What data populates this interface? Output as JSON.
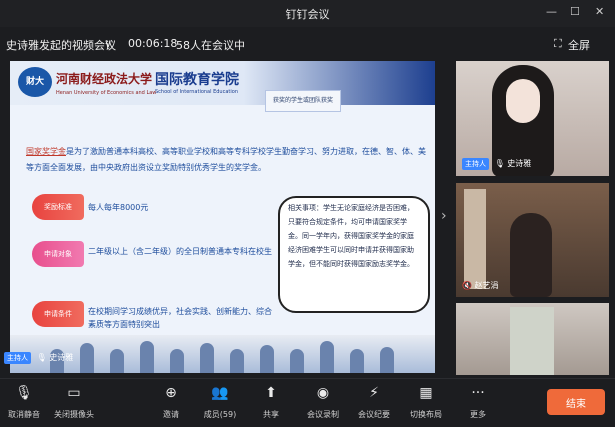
{
  "window": {
    "title": "钉钉会议",
    "minimize_glyph": "—",
    "maximize_glyph": "☐",
    "close_glyph": "✕"
  },
  "meeting": {
    "name": "史诗雅发起的视频会议",
    "dropdown_glyph": "∨",
    "duration": "00:06:18",
    "participants_status": "58人在会议中",
    "fullscreen_label": "全屏"
  },
  "slide": {
    "logo_text": "财大",
    "university_cn": "河南财经政法大学",
    "university_en": "Henan University of Economics and Law",
    "school_cn": "国际教育学院",
    "school_en": "School of International Education",
    "notice_box": "获奖的学生或团队获奖",
    "intro_keyword": "国家奖学金",
    "intro_text": "是为了激励普通本科高校、高等职业学校和高等专科学校学生勤奋学习、努力进取，在德、智、体、美等方面全面发展，由中央政府出资设立奖励特别优秀学生的奖学金。",
    "items": [
      {
        "tag": "奖励标准",
        "text": "每人每年8000元"
      },
      {
        "tag": "申请对象",
        "text": "二年级以上（含二年级）的全日制普通本专科在校生"
      },
      {
        "tag": "申请条件",
        "text": "在校期间学习成绩优异，社会实践、创新能力、综合素质等方面特别突出"
      }
    ],
    "note": "相关事项：学生无论家庭经济是否困难，只要符合规定条件，均可申请国家奖学金。同一学年内，获得国家奖学金的家庭经济困难学生可以同时申请并获得国家助学金，但不能同时获得国家励志奖学金。"
  },
  "speaker": {
    "badge": "主持人",
    "mic_glyph": "🎙",
    "name": "史诗雅"
  },
  "tiles": [
    {
      "badge": "主持人",
      "name": "史诗雅"
    },
    {
      "badge": "",
      "name": "赵艺涓"
    },
    {
      "badge": "",
      "name": ""
    }
  ],
  "toolbar": {
    "buttons": [
      {
        "icon": "🎙",
        "label": "取消静音"
      },
      {
        "icon": "▭",
        "label": "关闭摄像头"
      },
      {
        "icon": "⊕",
        "label": "邀请"
      },
      {
        "icon": "👥",
        "label": "成员(59)"
      },
      {
        "icon": "⬆",
        "label": "共享"
      },
      {
        "icon": "◉",
        "label": "会议录制"
      },
      {
        "icon": "⚡",
        "label": "会议纪要"
      },
      {
        "icon": "▦",
        "label": "切换布局"
      },
      {
        "icon": "···",
        "label": "更多"
      }
    ],
    "end_label": "结束"
  },
  "colors": {
    "accent_blue": "#3a86ff",
    "end_button": "#ef6a3a",
    "slide_text": "#1e4d9c",
    "tag_red": "#e8433f",
    "tag_pink": "#e84f8d"
  }
}
